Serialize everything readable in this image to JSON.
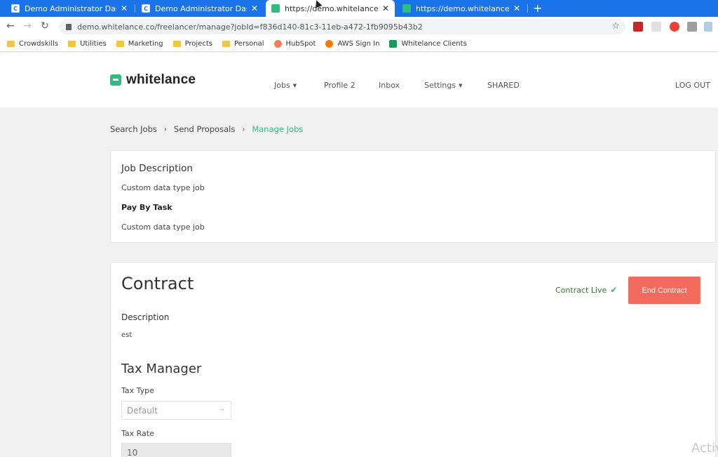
{
  "browser": {
    "tabs": [
      {
        "label": "Demo Administrator Dashboard",
        "favicon": "c-icon",
        "active": false
      },
      {
        "label": "Demo Administrator Dashboard",
        "favicon": "c-icon",
        "active": false
      },
      {
        "label": "https://demo.whitelance.co/freel",
        "favicon": "whitelance-icon",
        "active": true
      },
      {
        "label": "https://demo.whitelance.co/freel",
        "favicon": "whitelance-icon",
        "active": false
      }
    ],
    "close_glyph": "✕",
    "new_tab_glyph": "+",
    "url": "demo.whitelance.co/freelancer/manage?jobId=f836d140-81c3-11eb-a472-1fb9095b43b2",
    "accent_color": "#1a73e8"
  },
  "bookmarks": [
    {
      "label": "Crowdskills",
      "icon": "folder-icon"
    },
    {
      "label": "Utilities",
      "icon": "folder-icon"
    },
    {
      "label": "Marketing",
      "icon": "folder-icon"
    },
    {
      "label": "Projects",
      "icon": "folder-icon"
    },
    {
      "label": "Personal",
      "icon": "folder-icon"
    },
    {
      "label": "HubSpot",
      "icon": "hubspot-icon"
    },
    {
      "label": "AWS Sign In",
      "icon": "aws-icon"
    },
    {
      "label": "Whitelance Clients",
      "icon": "sheets-icon"
    }
  ],
  "header": {
    "logo_text": "whitelance",
    "brand_color": "#2ebd7e",
    "nav": {
      "jobs": "Jobs",
      "profile": "Profile 2",
      "inbox": "Inbox",
      "settings": "Settings",
      "shared": "SHARED",
      "logout": "LOG OUT"
    }
  },
  "breadcrumb": {
    "items": [
      "Search Jobs",
      "Send Proposals",
      "Manage Jobs"
    ],
    "separator": "›"
  },
  "job": {
    "heading": "Job Description",
    "description": "Custom data type job",
    "payment_label": "Pay By Task",
    "payment_text": "Custom data type job"
  },
  "contract": {
    "title": "Contract",
    "status": "Contract Live",
    "end_button": "End Contract",
    "description_label": "Description",
    "description_value": "est",
    "tax": {
      "heading": "Tax Manager",
      "type_label": "Tax Type",
      "type_value": "Default",
      "rate_label": "Tax Rate",
      "rate_value": "10"
    }
  },
  "watermark": "Activ"
}
